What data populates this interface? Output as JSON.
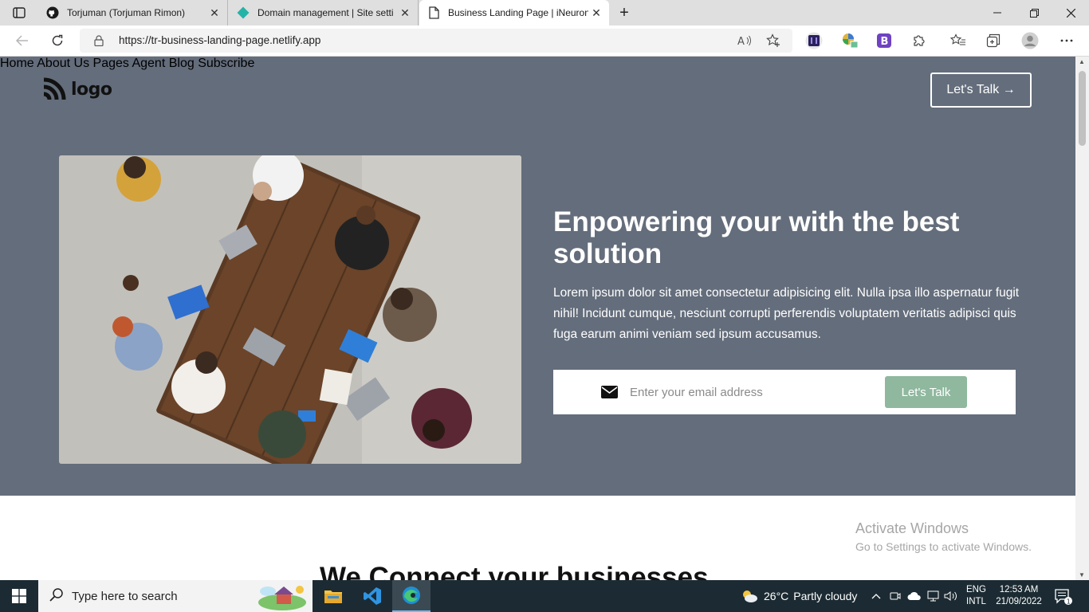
{
  "browser": {
    "tabs": [
      {
        "title": "Torjuman (Torjuman Rimon)",
        "icon": "github-icon"
      },
      {
        "title": "Domain management | Site setti",
        "icon": "netlify-icon"
      },
      {
        "title": "Business Landing Page | iNeuron",
        "icon": "page-icon"
      }
    ],
    "url": "https://tr-business-landing-page.netlify.app"
  },
  "site": {
    "logo_text": "logo",
    "nav": [
      "Home",
      "About Us",
      "Pages",
      "Agent",
      "Blog",
      "Subscribe"
    ],
    "cta_label": "Let's Talk →",
    "headline": "Enpowering your with the best solution",
    "lead": "Lorem ipsum dolor sit amet consectetur adipisicing elit. Nulla ipsa illo aspernatur fugit nihil! Incidunt cumque, nesciunt corrupti perferendis voluptatem veritatis adipisci quis fuga earum animi veniam sed ipsum accusamus.",
    "email_placeholder": "Enter your email address",
    "submit_label": "Let's Talk",
    "section2_title": "We Connect your businesses",
    "colors": {
      "hero_bg": "#646d7b",
      "accent": "#8fb89e"
    }
  },
  "watermark": {
    "line1": "Activate Windows",
    "line2": "Go to Settings to activate Windows."
  },
  "taskbar": {
    "search_placeholder": "Type here to search",
    "weather_temp": "26°C",
    "weather_desc": "Partly cloudy",
    "lang_top": "ENG",
    "lang_bottom": "INTL",
    "time": "12:53 AM",
    "date": "21/09/2022",
    "notification_count": "1"
  }
}
